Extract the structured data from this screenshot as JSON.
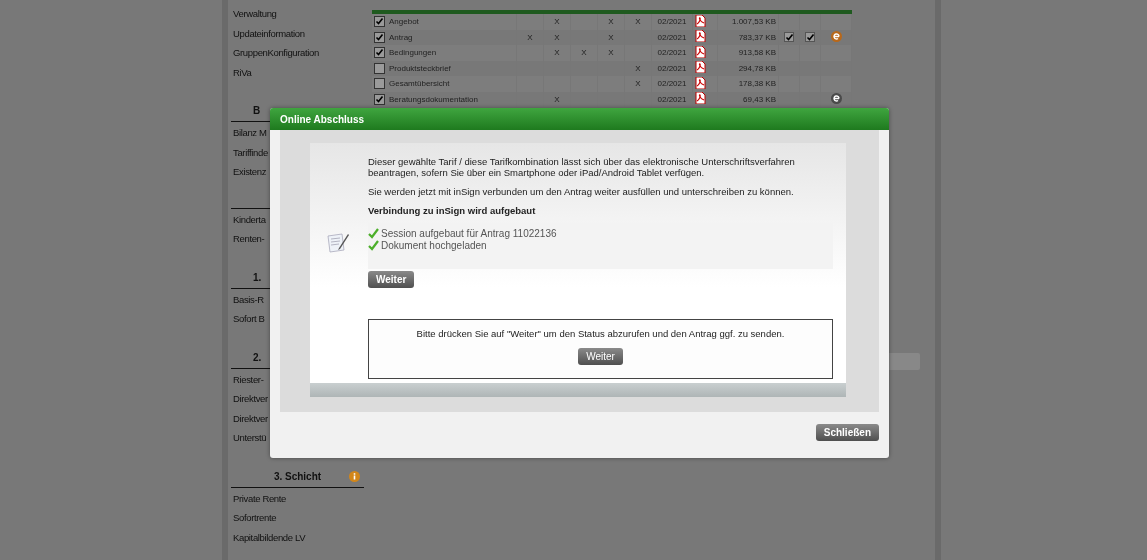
{
  "sidebar": {
    "sections": [
      {
        "items": [
          "Verwaltung",
          "Updateinformation",
          "GruppenKonfiguration",
          "RiVa"
        ]
      },
      {
        "heading": "B",
        "items": [
          "Bilanz M",
          "Tariffinde",
          "Existenz"
        ]
      },
      {
        "items": [
          "Kinderta",
          "Renten-"
        ]
      },
      {
        "heading": "1.",
        "items": [
          "Basis-R",
          "Sofort B"
        ]
      },
      {
        "heading": "2.",
        "items": [
          "Riester-",
          "Direktver",
          "Direktver",
          "Unterstü"
        ]
      },
      {
        "heading": "3. Schicht",
        "info_icon": true,
        "items": [
          "Private Rente",
          "Sofortrente",
          "Kapitalbildende LV"
        ]
      }
    ]
  },
  "documents": {
    "rows": [
      {
        "name": "Angebot",
        "checked": true,
        "marks": {
          "column_2": "X",
          "column_4": "X",
          "column_5": "X"
        },
        "date": "02/2021",
        "size": "1.007,53 KB"
      },
      {
        "name": "Antrag",
        "checked": true,
        "marks": {
          "column_1": "X",
          "column_2": "X",
          "column_4": "X"
        },
        "date": "02/2021",
        "size": "783,37 KB",
        "options": [
          true,
          true
        ],
        "signature_active": true
      },
      {
        "name": "Bedingungen",
        "checked": true,
        "marks": {
          "column_2": "X",
          "column_3": "X",
          "column_4": "X"
        },
        "date": "02/2021",
        "size": "913,58 KB"
      },
      {
        "name": "Produktsteckbrief",
        "checked": false,
        "marks": {
          "column_5": "X"
        },
        "date": "02/2021",
        "size": "294,78 KB"
      },
      {
        "name": "Gesamtübersicht",
        "checked": false,
        "marks": {
          "column_5": "X"
        },
        "date": "02/2021",
        "size": "178,38 KB"
      },
      {
        "name": "Beratungsdokumentation",
        "checked": true,
        "marks": {
          "column_2": "X"
        },
        "date": "02/2021",
        "size": "69,43 KB",
        "signature_active": false
      }
    ]
  },
  "dialog": {
    "title": "Online Abschluss",
    "paragraphs": [
      "Dieser gewählte Tarif / diese Tarifkombination lässt sich über das elektronische Unterschriftsverfahren beantragen, sofern Sie über ein Smartphone oder iPad/Android Tablet verfügen.",
      "Sie werden jetzt mit inSign verbunden um den Antrag weiter ausfüllen und unterschreiben zu können."
    ],
    "status_heading": "Verbindung zu inSign wird aufgebaut",
    "steps": [
      {
        "text": "Session aufgebaut für Antrag 11022136",
        "done": true
      },
      {
        "text": "Dokument hochgeladen",
        "done": true
      }
    ],
    "step_button": "Weiter",
    "notice": "Bitte drücken Sie auf \"Weiter\" um den Status abzurufen und den Antrag ggf. zu senden.",
    "notice_button": "Weiter",
    "close_button": "Schließen"
  }
}
